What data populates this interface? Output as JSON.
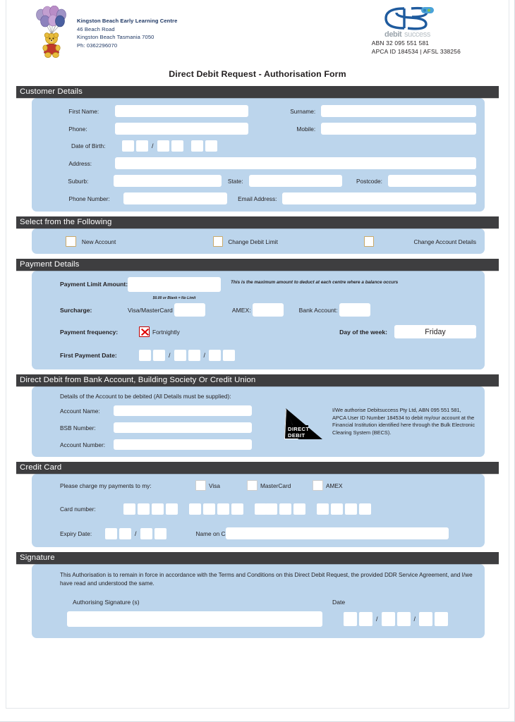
{
  "header": {
    "org_name": "Kingston Beach Early Learning Centre",
    "org_street": "46 Beach Road",
    "org_city": "Kingston Beach   Tasmania   7050",
    "org_phone": "Ph: 0362296070",
    "brand_logo_text": "ds",
    "brand_logo_sub": "debitsuccess",
    "abn_line": "ABN 32 095 551 581",
    "apca_line": "APCA ID 184534  |  AFSL 338256"
  },
  "title": "Direct Debit Request - Authorisation Form",
  "customer_details": {
    "section_title": "Customer Details",
    "first_name_label": "First Name:",
    "first_name_value": "",
    "surname_label": "Surname:",
    "surname_value": "",
    "phone_label": "Phone:",
    "phone_value": "",
    "mobile_label": "Mobile:",
    "mobile_value": "",
    "dob_label": "Date of Birth:",
    "dob_separator": "/",
    "address_label": "Address:",
    "address_value": "",
    "suburb_label": "Suburb:",
    "suburb_value": "",
    "state_label": "State:",
    "state_value": "",
    "postcode_label": "Postcode:",
    "postcode_value": "",
    "phone_number_label": "Phone Number:",
    "phone_number_value": "",
    "email_label": "Email Address:",
    "email_value": ""
  },
  "select_following": {
    "section_title": "Select from the Following",
    "options": [
      {
        "label": "New Account",
        "checked": false
      },
      {
        "label": "Change Debit Limit",
        "checked": false
      },
      {
        "label": "Change Account Details",
        "checked": false
      }
    ]
  },
  "payment_details": {
    "section_title": "Payment Details",
    "limit_label": "Payment Limit Amount:",
    "limit_value": "",
    "limit_note": "This is the maximum amount to deduct at each centre where a balance occurs",
    "limit_subnote": "$0.00 or Blank = No Limit",
    "surcharge_label": "Surcharge:",
    "surcharge_visa_label": "Visa/MasterCard",
    "surcharge_visa_value": "",
    "surcharge_amex_label": "AMEX:",
    "surcharge_amex_value": "",
    "surcharge_bank_label": "Bank Account:",
    "surcharge_bank_value": "",
    "frequency_label": "Payment frequency:",
    "frequency_option": "Fortnightly",
    "frequency_checked": true,
    "day_label": "Day of the week:",
    "day_value": "Friday",
    "first_payment_label": "First Payment Date:",
    "date_separator": "/"
  },
  "bank_account": {
    "section_title": "Direct Debit from Bank Account, Building Society Or Credit Union",
    "intro": "Details of the Account to be debited (All Details must be supplied):",
    "account_name_label": "Account Name:",
    "account_name_value": "",
    "bsb_label": "BSB Number:",
    "bsb_value": "",
    "account_number_label": "Account Number:",
    "account_number_value": "",
    "dd_logo_line1": "DIRECT",
    "dd_logo_line2": "DEBIT",
    "authorisation": "I/We authorise Debitsuccess Pty Ltd, ABN 095 551 581, APCA User ID Number 184534 to debit my/our account at the Financial Institution identified here through the Bulk Electronic Clearing System (BECS)."
  },
  "credit_card": {
    "section_title": "Credit Card",
    "charge_label": "Please charge my payments to my:",
    "card_types": [
      {
        "label": "Visa",
        "checked": false
      },
      {
        "label": "MasterCard",
        "checked": false
      },
      {
        "label": "AMEX",
        "checked": false
      }
    ],
    "card_number_label": "Card number:",
    "card_number_separator": "/",
    "expiry_label": "Expiry Date:",
    "expiry_separator": "/",
    "name_on_card_label": "Name on Card:",
    "name_on_card_value": ""
  },
  "signature": {
    "section_title": "Signature",
    "terms": "This Authorisation is to remain in force in accordance with the Terms and Conditions on this Direct Debit Request, the provided DDR Service Agreement, and I/we have read and understood the same.",
    "signature_label": "Authorising Signature (s)",
    "signature_value": "",
    "date_label": "Date",
    "date_separator": "/"
  },
  "colors": {
    "panel_blue": "#bcd5ec",
    "bar_dark": "#3e3e40",
    "org_text": "#1f3864",
    "red_x": "#e00000"
  }
}
